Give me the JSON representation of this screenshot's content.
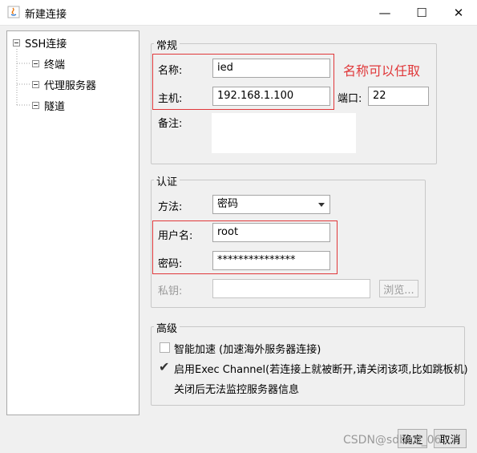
{
  "window": {
    "title": "新建连接",
    "minimize": "—",
    "maximize": "☐",
    "close": "✕"
  },
  "tree": {
    "root": "SSH连接",
    "children": [
      "终端",
      "代理服务器",
      "隧道"
    ]
  },
  "general": {
    "legend": "常规",
    "name_label": "名称:",
    "name_value": "ied",
    "host_label": "主机:",
    "host_value": "192.168.1.100",
    "port_label": "端口:",
    "port_value": "22",
    "note_label": "备注:",
    "annotation": "名称可以任取"
  },
  "auth": {
    "legend": "认证",
    "method_label": "方法:",
    "method_value": "密码",
    "user_label": "用户名:",
    "user_value": "root",
    "password_label": "密码:",
    "password_value": "***************",
    "key_label": "私钥:",
    "browse_label": "浏览..."
  },
  "advanced": {
    "legend": "高级",
    "opt1_label": "智能加速 (加速海外服务器连接)",
    "opt1_checked": false,
    "opt2_label": "启用Exec Channel(若连接上就被断开,请关闭该项,比如跳板机)",
    "opt2_checked": true,
    "opt2_note": "关闭后无法监控服务器信息"
  },
  "buttons": {
    "ok": "确定",
    "cancel": "取消"
  },
  "watermark": "CSDN@sdbzzl_06...",
  "colors": {
    "annotation": "#e0383a",
    "window_bg": "#f0f0f0"
  }
}
